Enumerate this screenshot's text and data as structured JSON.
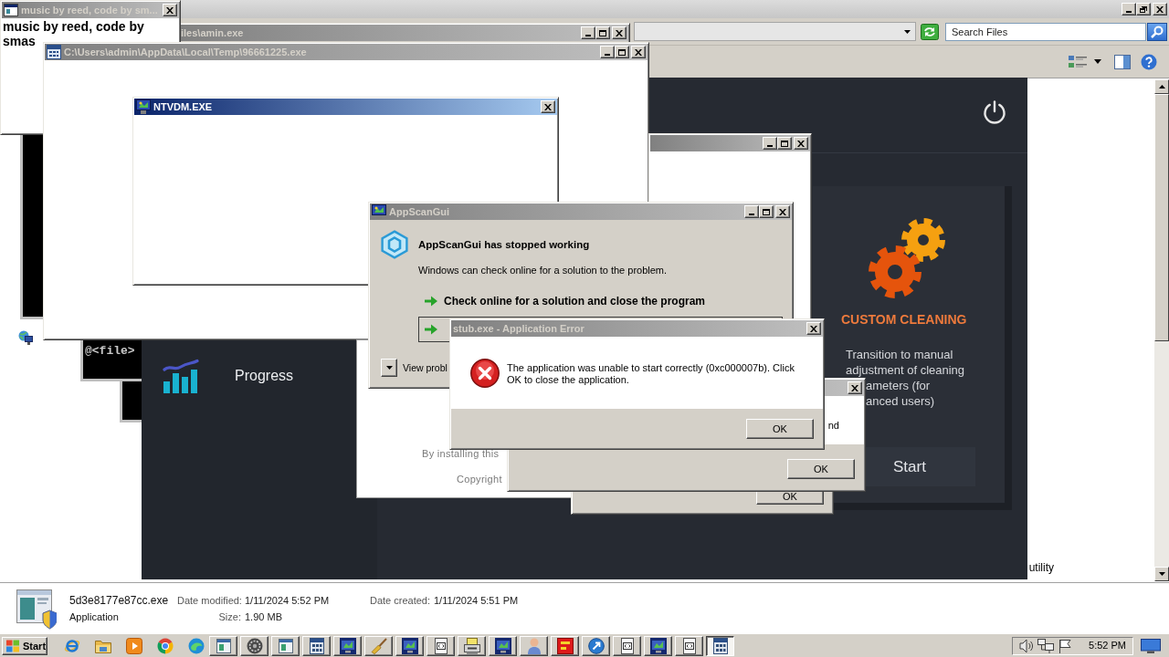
{
  "explorer": {
    "search": {
      "placeholder": "Search Files"
    },
    "file_list": {
      "cells": [
        "utility"
      ]
    },
    "details_pane": {
      "file_name": "5d3e8177e87cc.exe",
      "file_type": "Application",
      "properties": [
        {
          "label": "Date modified:",
          "value": "1/11/2024 5:52 PM"
        },
        {
          "label": "Date created:",
          "value": "1/11/2024 5:51 PM"
        },
        {
          "label": "Size:",
          "value": "1.90 MB"
        }
      ]
    }
  },
  "music_window": {
    "title": "music by reed, code by sm...",
    "active": false,
    "body_lines": [
      "music by reed, code by",
      "smas"
    ]
  },
  "amin_window": {
    "title": "iles\\amin.exe",
    "active": false
  },
  "temp_window": {
    "title": "C:\\Users\\admin\\AppData\\Local\\Temp\\96661225.exe",
    "active": false
  },
  "ntvdm_window": {
    "title": "NTVDM.EXE",
    "active": true
  },
  "console_window": {
    "text": "@<file>"
  },
  "cleaner_app": {
    "sidebar": [
      {
        "label": "Progress"
      }
    ],
    "card": {
      "title": "CUSTOM CLEANING",
      "description_lines": [
        "Transition to manual",
        "adjustment of cleaning",
        "ameters (for",
        "anced users)"
      ],
      "button": "Start"
    }
  },
  "blank_window": {
    "active": false
  },
  "installer_window": {
    "lines": [
      "By installing this",
      "Copyright"
    ]
  },
  "back_dialog": {
    "button": "OK"
  },
  "middle_dialog": {
    "active": false,
    "text": "nd",
    "button": "OK"
  },
  "appscan_dialog": {
    "title": "AppScanGui",
    "active": false,
    "heading": "AppScanGui has stopped working",
    "message": "Windows can check online for a solution to the problem.",
    "options": [
      {
        "label": "Check online for a solution and close the program",
        "focused": false
      },
      {
        "focused": true
      }
    ],
    "details_toggle": "View probl"
  },
  "error_dialog": {
    "title": "stub.exe - Application Error",
    "active": false,
    "message": "The application was unable to start correctly (0xc000007b). Click OK to close the application.",
    "button": "OK"
  },
  "taskbar": {
    "start": "Start",
    "quick_launch": [
      {
        "kind": "globe"
      },
      {
        "kind": "folder"
      },
      {
        "kind": "player"
      },
      {
        "kind": "wheel"
      },
      {
        "kind": "wave"
      }
    ],
    "tasks": [
      {
        "kind": "window",
        "selected": false
      },
      {
        "kind": "disc",
        "selected": false
      },
      {
        "kind": "window",
        "selected": false
      },
      {
        "kind": "calculator",
        "selected": false
      },
      {
        "kind": "program",
        "selected": false
      },
      {
        "kind": "broom",
        "selected": false
      },
      {
        "kind": "program",
        "selected": false
      },
      {
        "kind": "console",
        "selected": false
      },
      {
        "kind": "installer",
        "selected": false
      },
      {
        "kind": "program",
        "selected": false
      },
      {
        "kind": "person",
        "selected": false
      },
      {
        "kind": "tile",
        "selected": false
      },
      {
        "kind": "roundel",
        "selected": false
      },
      {
        "kind": "console",
        "selected": false
      },
      {
        "kind": "program",
        "selected": false
      },
      {
        "kind": "console",
        "selected": false
      },
      {
        "kind": "calculator",
        "selected": true
      }
    ],
    "clock": "5:52 PM"
  }
}
